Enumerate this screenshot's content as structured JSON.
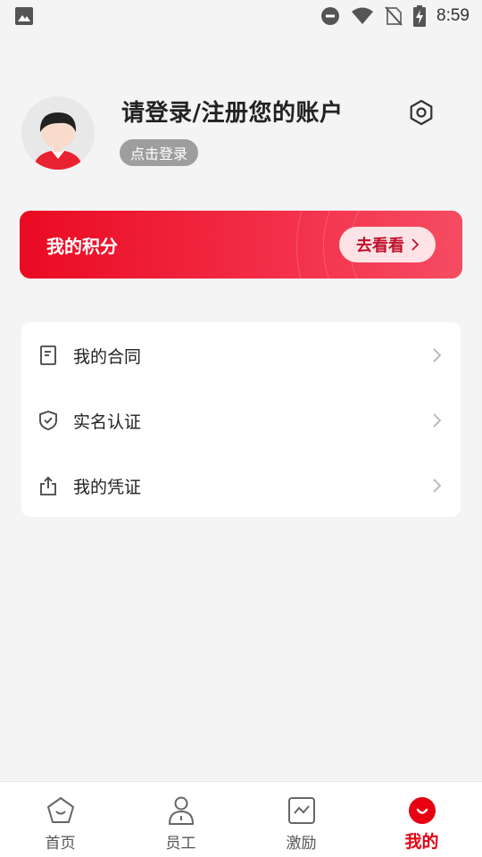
{
  "status_bar": {
    "time": "8:59",
    "icons": [
      "image-icon",
      "do-not-disturb-icon",
      "wifi-icon",
      "no-sim-icon",
      "battery-charging-icon"
    ]
  },
  "profile": {
    "title": "请登录/注册您的账户",
    "login_chip": "点击登录",
    "avatar_icon": "default-avatar",
    "settings_icon": "settings-hexagon-icon"
  },
  "points_card": {
    "title": "我的积分",
    "button_label": "去看看",
    "gradient_start": "#ea0a22",
    "gradient_end": "#f54c62"
  },
  "menu": {
    "items": [
      {
        "label": "我的合同",
        "icon": "document-icon"
      },
      {
        "label": "实名认证",
        "icon": "shield-check-icon"
      },
      {
        "label": "我的凭证",
        "icon": "share-upload-icon"
      }
    ]
  },
  "bottom_nav": {
    "items": [
      {
        "label": "首页",
        "icon": "home-pentagon-icon",
        "active": false
      },
      {
        "label": "员工",
        "icon": "employee-icon",
        "active": false
      },
      {
        "label": "激励",
        "icon": "chart-square-icon",
        "active": false
      },
      {
        "label": "我的",
        "icon": "smile-circle-icon",
        "active": true
      }
    ],
    "active_color": "#e60012"
  }
}
